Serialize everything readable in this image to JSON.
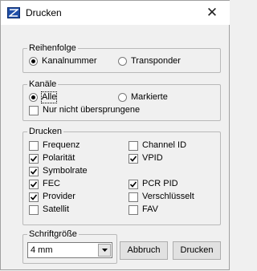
{
  "window": {
    "title": "Drucken",
    "close_glyph": "✕"
  },
  "reihenfolge": {
    "legend": "Reihenfolge",
    "options": [
      {
        "label": "Kanalnummer",
        "selected": true
      },
      {
        "label": "Transponder",
        "selected": false
      }
    ]
  },
  "kanaele": {
    "legend": "Kanäle",
    "options": [
      {
        "label": "Alle",
        "selected": true
      },
      {
        "label": "Markierte",
        "selected": false
      }
    ],
    "skip_checkbox": {
      "label": "Nur nicht übersprungene",
      "checked": false
    }
  },
  "drucken": {
    "legend": "Drucken",
    "left": [
      {
        "label": "Frequenz",
        "checked": false
      },
      {
        "label": "Polarität",
        "checked": true
      },
      {
        "label": "Symbolrate",
        "checked": true
      },
      {
        "label": "FEC",
        "checked": true
      },
      {
        "label": "Provider",
        "checked": true
      },
      {
        "label": "Satellit",
        "checked": false
      }
    ],
    "right": [
      {
        "label": "Channel ID",
        "checked": false
      },
      {
        "label": "VPID",
        "checked": true
      },
      {
        "label": "PCR PID",
        "checked": true
      },
      {
        "label": "Verschlüsselt",
        "checked": false
      },
      {
        "label": "FAV",
        "checked": false
      }
    ]
  },
  "schriftgroesse": {
    "legend": "Schriftgröße",
    "selected": "4 mm"
  },
  "buttons": {
    "cancel": "Abbruch",
    "print": "Drucken"
  },
  "icons": {
    "app": "satellite-tv-app-icon",
    "close": "close-icon",
    "dropdown": "chevron-down-icon"
  }
}
